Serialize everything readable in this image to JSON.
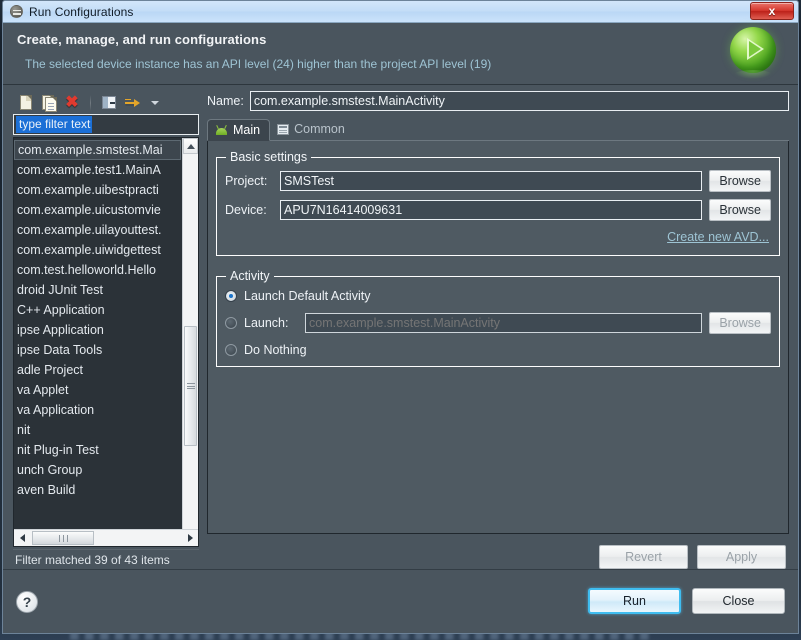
{
  "window": {
    "title": "Run Configurations",
    "close_label": "x"
  },
  "banner": {
    "heading": "Create, manage, and run configurations",
    "message": "The selected device instance has an API level (24) higher than the project API level (19)"
  },
  "tree_toolbar": {
    "new_label": "new-configuration",
    "duplicate_label": "duplicate-configuration",
    "delete_label": "delete-configuration",
    "collapse_label": "collapse-all",
    "filter_label": "filter-configurations"
  },
  "filter": {
    "value": "type filter text",
    "status": "Filter matched 39 of 43 items"
  },
  "tree": {
    "items": [
      {
        "label": "com.example.smstest.Mai",
        "child": true,
        "selected": true
      },
      {
        "label": "com.example.test1.MainA",
        "child": true,
        "selected": false
      },
      {
        "label": "com.example.uibestpracti",
        "child": true,
        "selected": false
      },
      {
        "label": "com.example.uicustomvie",
        "child": true,
        "selected": false
      },
      {
        "label": "com.example.uilayouttest.",
        "child": true,
        "selected": false
      },
      {
        "label": "com.example.uiwidgettest",
        "child": true,
        "selected": false
      },
      {
        "label": "com.test.helloworld.Hello",
        "child": true,
        "selected": false
      },
      {
        "label": "droid JUnit Test",
        "child": false,
        "selected": false
      },
      {
        "label": "C++ Application",
        "child": false,
        "selected": false
      },
      {
        "label": "ipse Application",
        "child": false,
        "selected": false
      },
      {
        "label": "ipse Data Tools",
        "child": false,
        "selected": false
      },
      {
        "label": "adle Project",
        "child": false,
        "selected": false
      },
      {
        "label": "va Applet",
        "child": false,
        "selected": false
      },
      {
        "label": "va Application",
        "child": false,
        "selected": false
      },
      {
        "label": "nit",
        "child": false,
        "selected": false
      },
      {
        "label": "nit Plug-in Test",
        "child": false,
        "selected": false
      },
      {
        "label": "unch Group",
        "child": false,
        "selected": false
      },
      {
        "label": "aven Build",
        "child": false,
        "selected": false
      }
    ]
  },
  "config": {
    "name_label": "Name:",
    "name_value": "com.example.smstest.MainActivity"
  },
  "tabs": [
    {
      "label": "Main",
      "icon": "android-icon",
      "active": true
    },
    {
      "label": "Common",
      "icon": "table-icon",
      "active": false
    }
  ],
  "basic_settings": {
    "legend": "Basic settings",
    "project_label": "Project:",
    "project_value": "SMSTest",
    "project_browse": "Browse",
    "device_label": "Device:",
    "device_value": "APU7N16414009631",
    "device_browse": "Browse",
    "create_avd_link": "Create new AVD..."
  },
  "activity": {
    "legend": "Activity",
    "options": [
      {
        "label": "Launch Default Activity",
        "selected": true
      },
      {
        "label": "Launch:",
        "selected": false
      },
      {
        "label": "Do Nothing",
        "selected": false
      }
    ],
    "launch_placeholder": "com.example.smstest.MainActivity",
    "launch_browse": "Browse"
  },
  "actions": {
    "revert": "Revert",
    "apply": "Apply"
  },
  "footer": {
    "help": "?",
    "run": "Run",
    "close": "Close"
  },
  "colors": {
    "accent_blue": "#3fbdf0",
    "link": "#9ec4d4",
    "panel_bg": "#4a555e",
    "tab_bg": "#3c454d",
    "selection": "#1b6fd6",
    "close_red": "#d4362c",
    "run_green": "#6fae24"
  }
}
